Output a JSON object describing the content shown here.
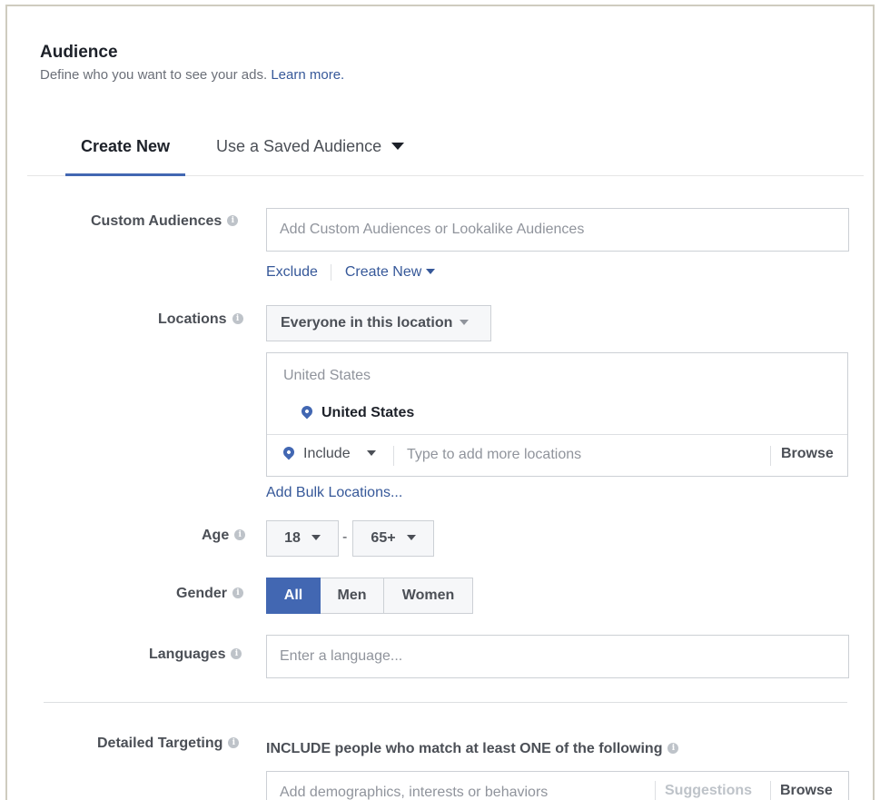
{
  "audience": {
    "title": "Audience",
    "subtitle": "Define who you want to see your ads.",
    "learn_more": "Learn more."
  },
  "tabs": [
    {
      "label": "Create New",
      "active": true
    },
    {
      "label": "Use a Saved Audience",
      "active": false
    }
  ],
  "custom_audiences": {
    "label": "Custom Audiences",
    "placeholder": "Add Custom Audiences or Lookalike Audiences",
    "exclude": "Exclude",
    "create_new": "Create New"
  },
  "locations": {
    "label": "Locations",
    "scope": "Everyone in this location",
    "country": "United States",
    "selected": "United States",
    "include": "Include",
    "placeholder": "Type to add more locations",
    "browse": "Browse",
    "bulk": "Add Bulk Locations..."
  },
  "age": {
    "label": "Age",
    "min": "18",
    "separator": "-",
    "max": "65+"
  },
  "gender": {
    "label": "Gender",
    "options": [
      "All",
      "Men",
      "Women"
    ],
    "selected": "All"
  },
  "languages": {
    "label": "Languages",
    "placeholder": "Enter a language..."
  },
  "detailed_targeting": {
    "label": "Detailed Targeting",
    "description": "INCLUDE people who match at least ONE of the following",
    "placeholder": "Add demographics, interests or behaviors",
    "suggestions": "Suggestions",
    "browse": "Browse"
  },
  "icons": {
    "info": "info-icon",
    "pin": "location-pin-icon",
    "caret": "chevron-down-icon"
  },
  "colors": {
    "accent": "#4267b2",
    "link": "#365899",
    "border": "#ccd0d5",
    "frame": "#cfccbf"
  }
}
